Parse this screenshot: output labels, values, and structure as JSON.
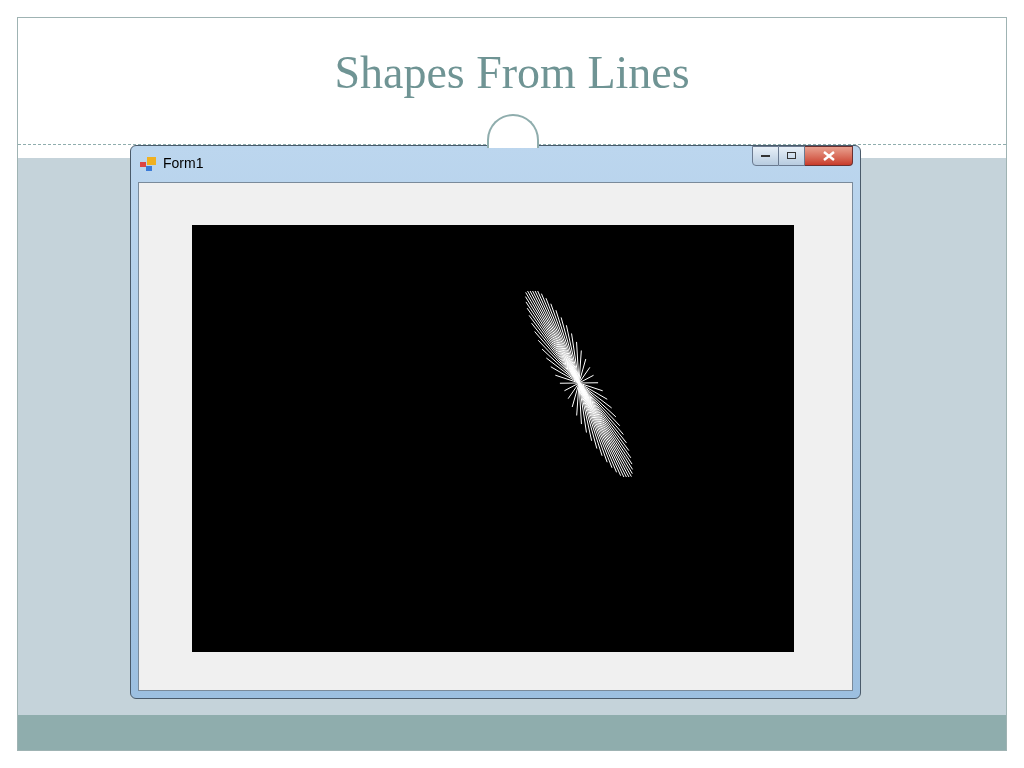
{
  "slide": {
    "title": "Shapes From Lines"
  },
  "window": {
    "title": "Form1"
  }
}
